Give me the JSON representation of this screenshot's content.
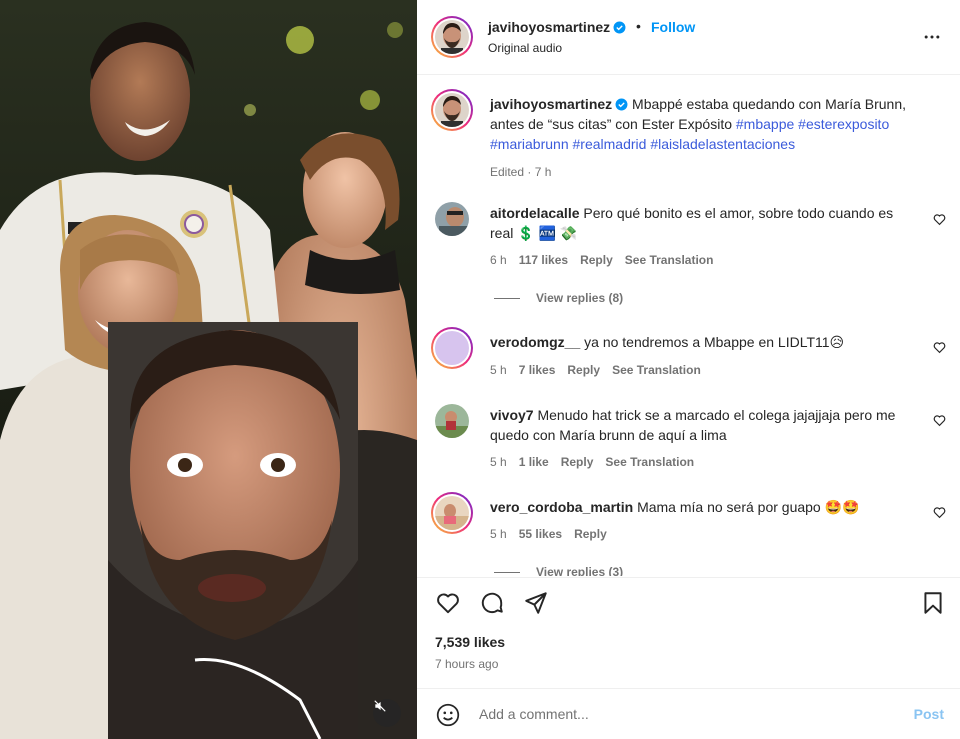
{
  "post": {
    "username": "javihoyosmartinez",
    "follow_label": "Follow",
    "separator": "•",
    "audio": "Original audio",
    "caption_text": "Mbappé estaba quedando con María Brunn, antes de “sus citas” con Ester Expósito",
    "hashtags": [
      "#mbappe",
      "#esterexposito",
      "#mariabrunn",
      "#realmadrid",
      "#laisladelastentaciones"
    ],
    "caption_meta": "Edited · 7 h",
    "likes": "7,539 likes",
    "time_ago": "7 hours ago"
  },
  "comments": [
    {
      "username": "aitordelacalle",
      "text": "Pero qué bonito es el amor, sobre todo cuando es real 💲 🏧 💸",
      "time": "6 h",
      "likes": "117 likes",
      "reply": "Reply",
      "translate": "See Translation",
      "view_replies": "View replies (8)"
    },
    {
      "username": "verodomgz__",
      "text": "ya no tendremos a Mbappe en LIDLT11😥",
      "time": "5 h",
      "likes": "7 likes",
      "reply": "Reply",
      "translate": "See Translation"
    },
    {
      "username": "vivoy7",
      "text": "Menudo hat trick se a marcado el colega jajajjaja pero me quedo con María brunn de aquí a lima",
      "time": "5 h",
      "likes": "1 like",
      "reply": "Reply",
      "translate": "See Translation"
    },
    {
      "username": "vero_cordoba_martin",
      "text": "Mama mía no será por guapo 🤩🤩",
      "time": "5 h",
      "likes": "55 likes",
      "reply": "Reply",
      "view_replies": "View replies (3)"
    }
  ],
  "add_comment": {
    "placeholder": "Add a comment...",
    "post_label": "Post"
  },
  "colors": {
    "link": "#0095f6",
    "hashtag": "#3b5bdb",
    "muted": "#737373",
    "text": "#262626"
  },
  "icons": [
    "heart-icon",
    "comment-icon",
    "share-icon",
    "bookmark-icon",
    "more-icon",
    "emoji-icon",
    "muted-audio-icon",
    "verified-icon"
  ]
}
